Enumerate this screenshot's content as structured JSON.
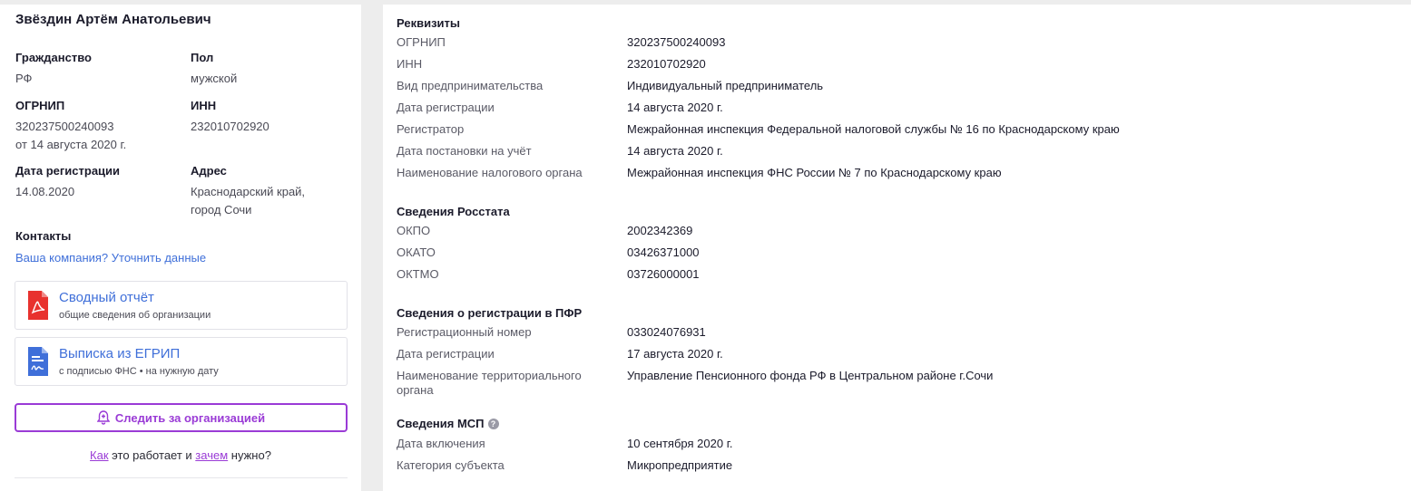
{
  "left": {
    "name": "Звёздин Артём Анатольевич",
    "citizenship_label": "Гражданство",
    "citizenship_value": "РФ",
    "sex_label": "Пол",
    "sex_value": "мужской",
    "ogrnip_label": "ОГРНИП",
    "ogrnip_value": "320237500240093",
    "ogrnip_date": "от 14 августа 2020 г.",
    "inn_label": "ИНН",
    "inn_value": "232010702920",
    "regdate_label": "Дата регистрации",
    "regdate_value": "14.08.2020",
    "address_label": "Адрес",
    "address_line1": "Краснодарский край,",
    "address_line2": "город Сочи",
    "contacts_label": "Контакты",
    "contacts_link": "Ваша компания? Уточнить данные",
    "card_report": {
      "title": "Сводный отчёт",
      "sub": "общие сведения об организации",
      "icon": "pdf-icon"
    },
    "card_egrip": {
      "title": "Выписка из ЕГРИП",
      "sub": "с подписью ФНС • на нужную дату",
      "icon": "document-signature-icon"
    },
    "follow_button": "Следить за организацией",
    "how_link": "Как",
    "how_mid": " это работает и ",
    "why_link": "зачем",
    "how_end": " нужно?"
  },
  "right": {
    "requisites": {
      "title": "Реквизиты",
      "rows": [
        {
          "k": "ОГРНИП",
          "v": "320237500240093"
        },
        {
          "k": "ИНН",
          "v": "232010702920"
        },
        {
          "k": "Вид предпринимательства",
          "v": "Индивидуальный предприниматель"
        },
        {
          "k": "Дата регистрации",
          "v": "14 августа 2020 г."
        },
        {
          "k": "Регистратор",
          "v": "Межрайонная инспекция Федеральной налоговой службы № 16 по Краснодарскому краю"
        },
        {
          "k": "Дата постановки на учёт",
          "v": "14 августа 2020 г."
        },
        {
          "k": "Наименование налогового органа",
          "v": "Межрайонная инспекция ФНС России № 7 по Краснодарскому краю"
        }
      ]
    },
    "rosstat": {
      "title": "Сведения Росстата",
      "rows": [
        {
          "k": "ОКПО",
          "v": "2002342369"
        },
        {
          "k": "ОКАТО",
          "v": "03426371000"
        },
        {
          "k": "ОКТМО",
          "v": "03726000001"
        }
      ]
    },
    "pfr": {
      "title": "Сведения о регистрации в ПФР",
      "rows": [
        {
          "k": "Регистрационный номер",
          "v": "033024076931"
        },
        {
          "k": "Дата регистрации",
          "v": "17 августа 2020 г."
        },
        {
          "k": "Наименование территориального органа",
          "v": "Управление Пенсионного фонда РФ в Центральном районе г.Сочи"
        }
      ]
    },
    "msp": {
      "title": "Сведения МСП",
      "rows": [
        {
          "k": "Дата включения",
          "v": "10 сентября 2020 г."
        },
        {
          "k": "Категория субъекта",
          "v": "Микропредприятие"
        }
      ]
    }
  },
  "colors": {
    "link": "#3f6fd9",
    "accent": "#9a3bd6",
    "pdf": "#e8322e",
    "doc": "#3f6fd9"
  }
}
